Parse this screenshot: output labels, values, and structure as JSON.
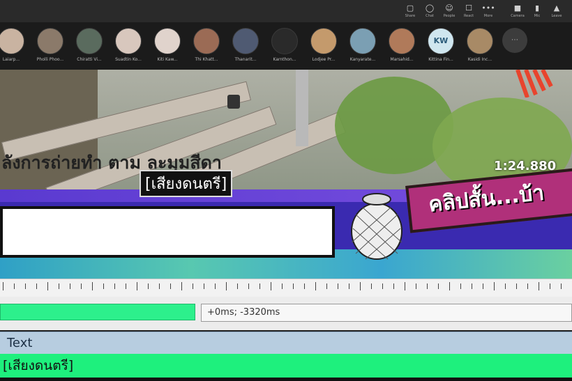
{
  "toolbar": {
    "icons": [
      {
        "name": "screen-share-icon",
        "glyph": "▢",
        "label": "Share"
      },
      {
        "name": "chat-icon",
        "glyph": "◯",
        "label": "Chat"
      },
      {
        "name": "participants-icon",
        "glyph": "☺",
        "label": "People"
      },
      {
        "name": "reactions-icon",
        "glyph": "☐",
        "label": "React"
      },
      {
        "name": "more-icon",
        "glyph": "•••",
        "label": "More"
      },
      {
        "name": "camera-icon",
        "glyph": "■",
        "label": "Camera"
      },
      {
        "name": "mic-icon",
        "glyph": "▮",
        "label": "Mic"
      },
      {
        "name": "leave-icon",
        "glyph": "▲",
        "label": "Leave"
      }
    ]
  },
  "participants": [
    {
      "name": "Laiarp..."
    },
    {
      "name": "Pholli Phoo..."
    },
    {
      "name": "Chiratti Vi..."
    },
    {
      "name": "Suadtin Ko..."
    },
    {
      "name": "Kiti Kaw..."
    },
    {
      "name": "Thi Khatt..."
    },
    {
      "name": "Thanarit..."
    },
    {
      "name": "Karnthon..."
    },
    {
      "name": "Lodjee Pr..."
    },
    {
      "name": "Kanyarate..."
    },
    {
      "name": "Marsahid..."
    },
    {
      "name": "Kittina Fin...",
      "initials": "KW"
    },
    {
      "name": "Kasidi Inc..."
    }
  ],
  "video": {
    "timestamp": "1:24.880",
    "subtitle_line": "ลังการถ่ายทำ ตาม ละมุมสีดา",
    "subtitle_tag": "[เสียงดนตรี]",
    "clip_label": "คลิปสั้น...บ้า"
  },
  "timing": {
    "offset_text": "+0ms; -3320ms"
  },
  "text_panel": {
    "header": "Text",
    "row_value": "[เสียงดนตรี]"
  }
}
